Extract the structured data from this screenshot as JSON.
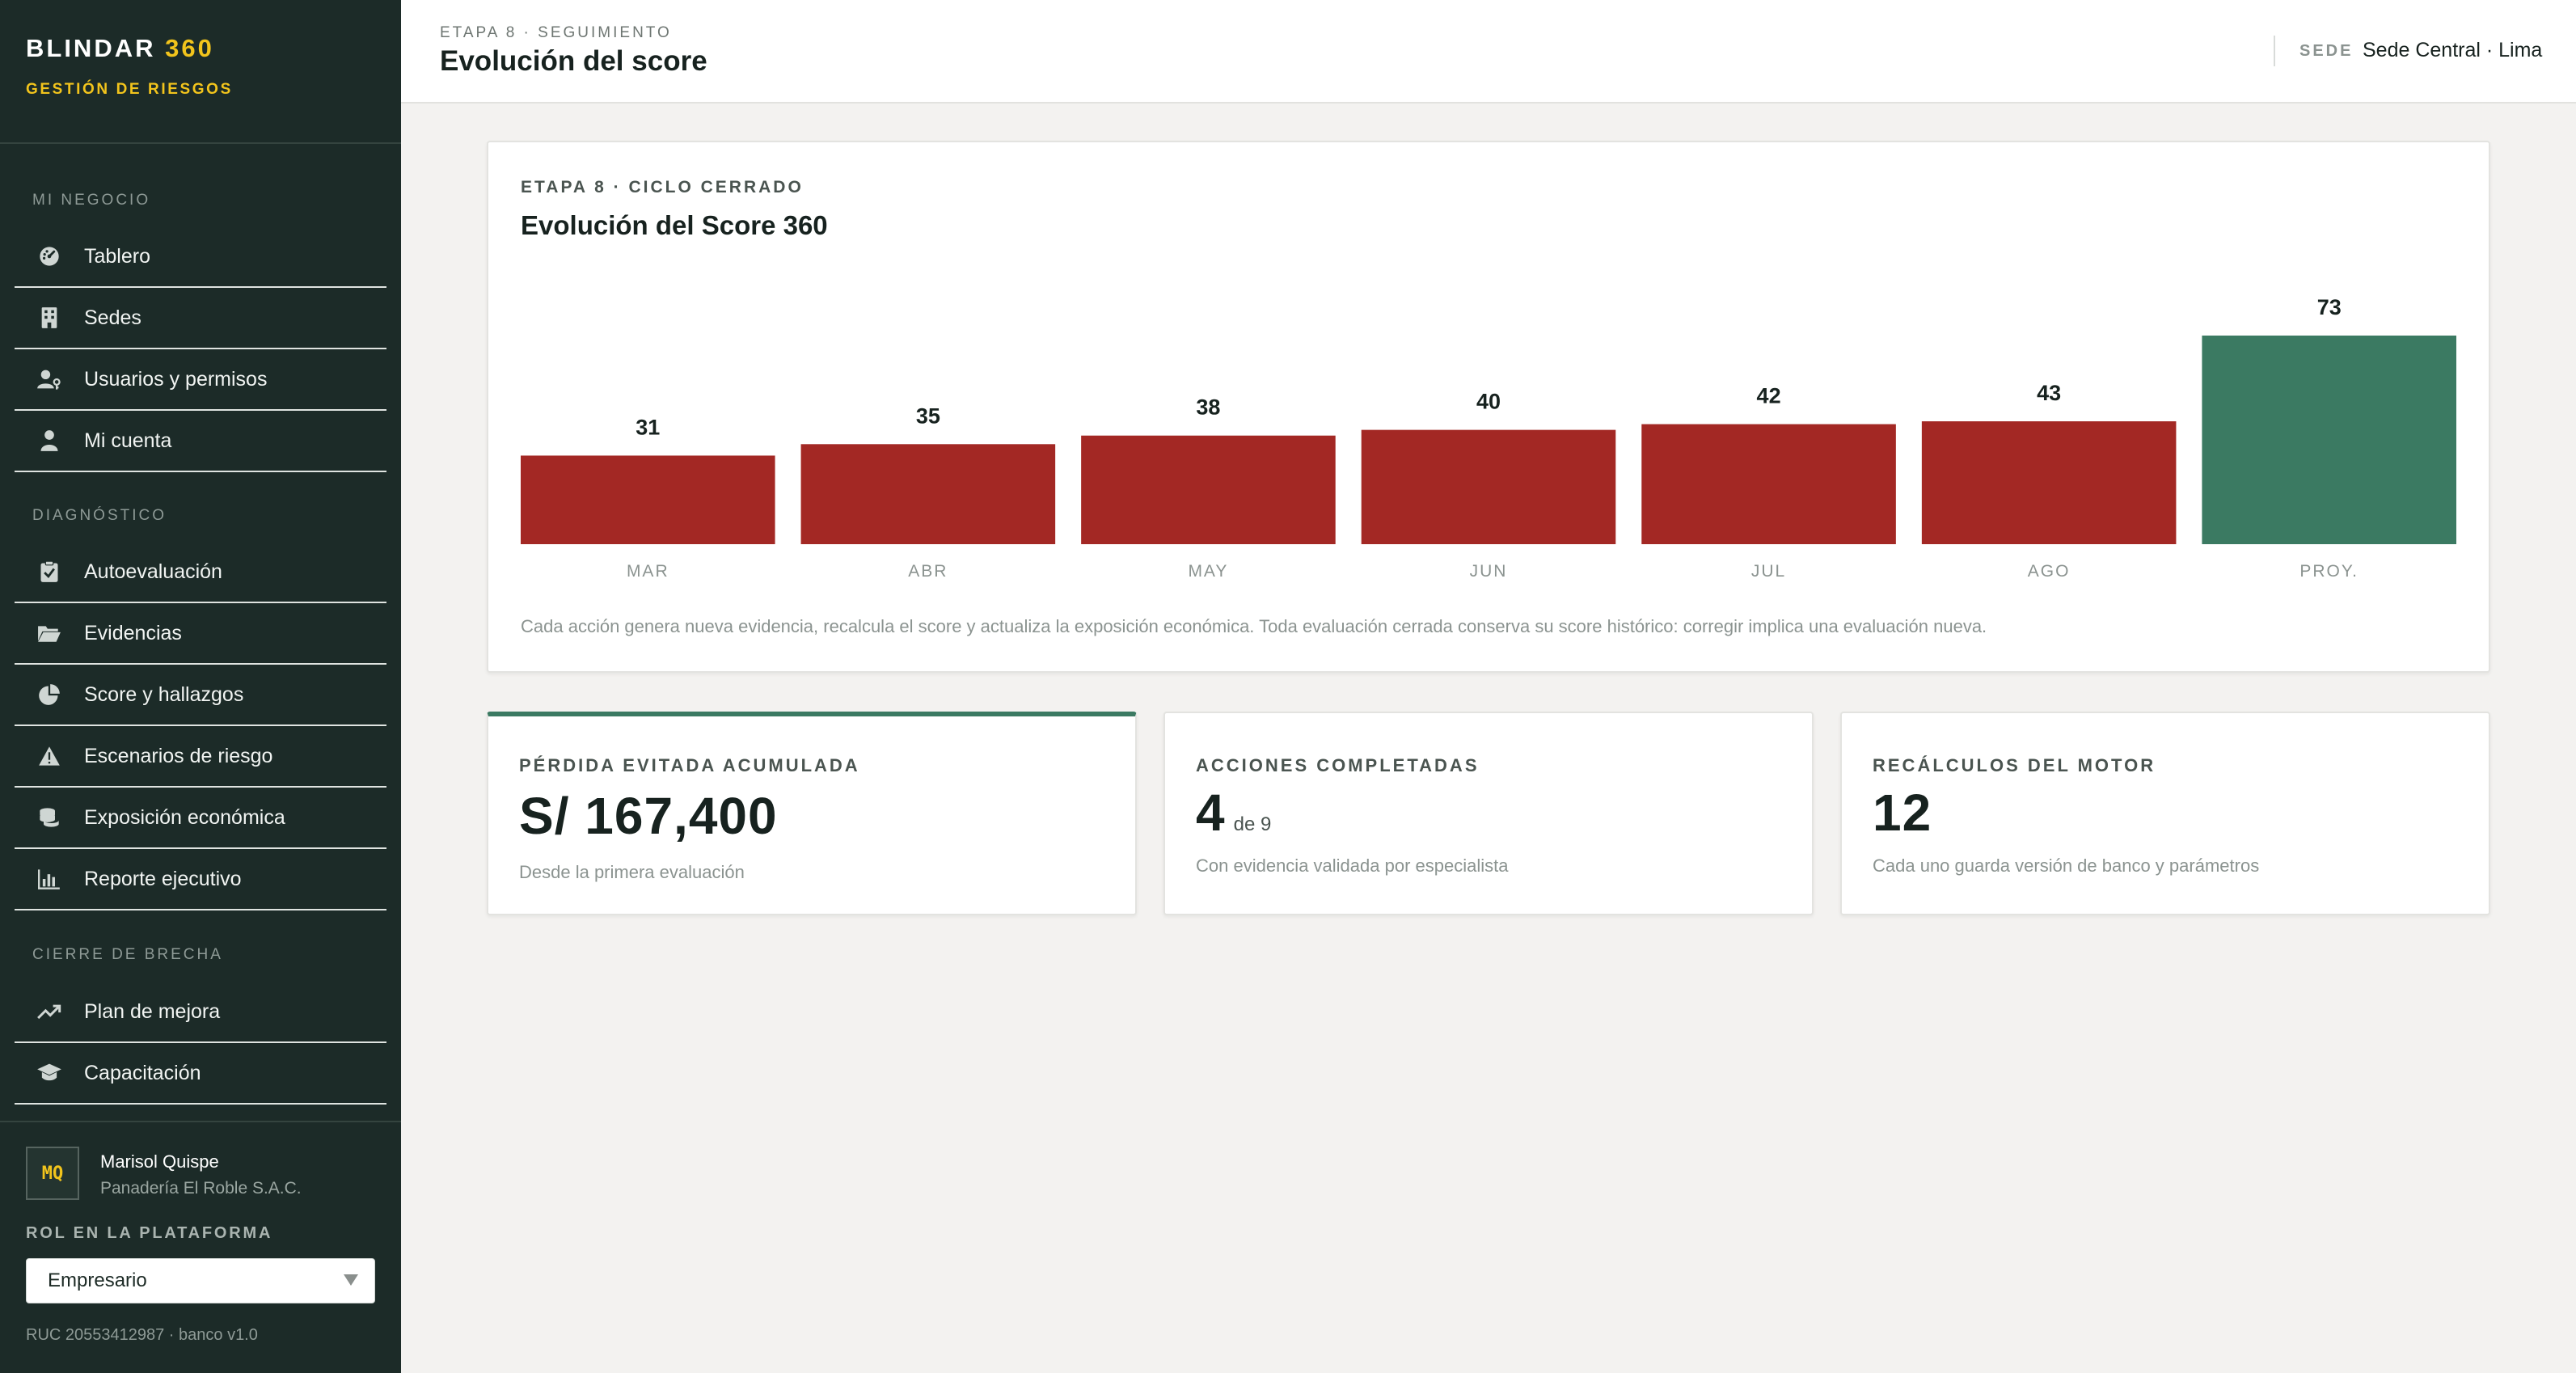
{
  "brand": {
    "name_main": "BLINDAR",
    "name_accent": "360",
    "subtitle": "GESTIÓN DE RIESGOS"
  },
  "sidebar": {
    "sections": [
      {
        "title": "MI NEGOCIO",
        "items": [
          {
            "label": "Tablero",
            "icon": "dashboard-icon"
          },
          {
            "label": "Sedes",
            "icon": "building-icon"
          },
          {
            "label": "Usuarios y permisos",
            "icon": "user-key-icon"
          },
          {
            "label": "Mi cuenta",
            "icon": "user-icon"
          }
        ]
      },
      {
        "title": "DIAGNÓSTICO",
        "items": [
          {
            "label": "Autoevaluación",
            "icon": "clipboard-check-icon"
          },
          {
            "label": "Evidencias",
            "icon": "folder-open-icon"
          },
          {
            "label": "Score y hallazgos",
            "icon": "pie-chart-icon"
          },
          {
            "label": "Escenarios de riesgo",
            "icon": "warning-icon"
          },
          {
            "label": "Exposición económica",
            "icon": "coins-icon"
          },
          {
            "label": "Reporte ejecutivo",
            "icon": "bar-chart-icon"
          }
        ]
      },
      {
        "title": "CIERRE DE BRECHA",
        "items": [
          {
            "label": "Plan de mejora",
            "icon": "trending-up-icon"
          },
          {
            "label": "Capacitación",
            "icon": "graduation-cap-icon"
          }
        ]
      }
    ],
    "user": {
      "initials": "MQ",
      "name": "Marisol Quispe",
      "company": "Panadería El Roble S.A.C."
    },
    "role_label": "ROL EN LA PLATAFORMA",
    "role_value": "Empresario",
    "footer": "RUC 20553412987 · banco v1.0"
  },
  "header": {
    "kicker": "ETAPA 8 · SEGUIMIENTO",
    "title": "Evolución del score",
    "sede_label": "SEDE",
    "sede_value": "Sede Central · Lima"
  },
  "chart_card": {
    "kicker": "ETAPA 8 · CICLO CERRADO",
    "title": "Evolución del Score 360",
    "note": "Cada acción genera nueva evidencia, recalcula el score y actualiza la exposición económica. Toda evaluación cerrada conserva su score histórico: corregir implica una evaluación nueva."
  },
  "chart_data": {
    "type": "bar",
    "categories": [
      "MAR",
      "ABR",
      "MAY",
      "JUN",
      "JUL",
      "AGO",
      "PROY."
    ],
    "values": [
      31,
      35,
      38,
      40,
      42,
      43,
      73
    ],
    "bar_colors": [
      "#a32824",
      "#a32824",
      "#a32824",
      "#a32824",
      "#a32824",
      "#a32824",
      "#3b7a62"
    ],
    "title": "Evolución del Score 360",
    "xlabel": "",
    "ylabel": "",
    "ylim": [
      0,
      73
    ],
    "grid": false,
    "data_labels": true
  },
  "metrics": [
    {
      "label": "PÉRDIDA EVITADA ACUMULADA",
      "value": "S/ 167,400",
      "suffix": "",
      "desc": "Desde la primera evaluación",
      "highlight": true
    },
    {
      "label": "ACCIONES COMPLETADAS",
      "value": "4",
      "suffix": "de 9",
      "desc": "Con evidencia validada por especialista",
      "highlight": false
    },
    {
      "label": "RECÁLCULOS DEL MOTOR",
      "value": "12",
      "suffix": "",
      "desc": "Cada uno guarda versión de banco y parámetros",
      "highlight": false
    }
  ],
  "colors": {
    "sidebar_bg": "#1c2b28",
    "accent": "#f2c41c",
    "bar_actual": "#a32824",
    "bar_projected": "#3b7a62"
  }
}
